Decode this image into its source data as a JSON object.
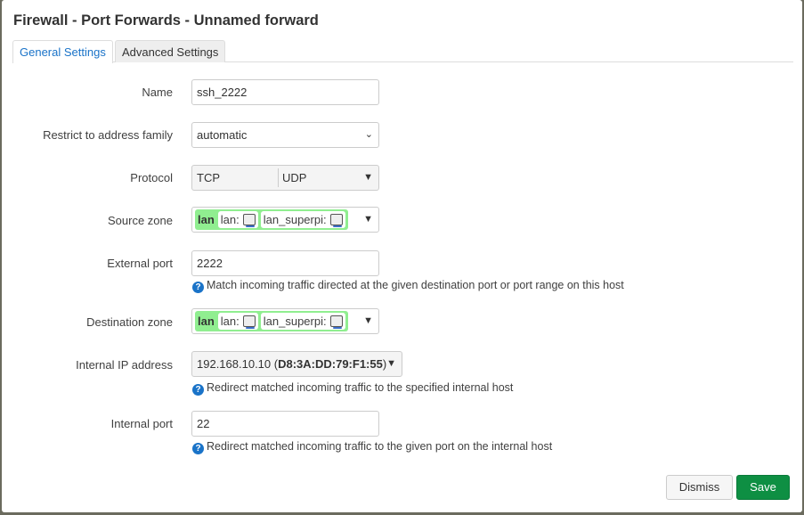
{
  "title": "Firewall - Port Forwards - Unnamed forward",
  "tabs": [
    {
      "label": "General Settings",
      "active": true
    },
    {
      "label": "Advanced Settings",
      "active": false
    }
  ],
  "fields": {
    "name": {
      "label": "Name",
      "value": "ssh_2222"
    },
    "family": {
      "label": "Restrict to address family",
      "value": "automatic"
    },
    "protocol": {
      "label": "Protocol",
      "values": [
        "TCP",
        "UDP"
      ]
    },
    "source_zone": {
      "label": "Source zone",
      "zone": "lan",
      "networks": [
        "lan:",
        "lan_superpi:"
      ]
    },
    "external_port": {
      "label": "External port",
      "value": "2222",
      "help": "Match incoming traffic directed at the given destination port or port range on this host"
    },
    "dest_zone": {
      "label": "Destination zone",
      "zone": "lan",
      "networks": [
        "lan:",
        "lan_superpi:"
      ]
    },
    "internal_ip": {
      "label": "Internal IP address",
      "ip": "192.168.10.10",
      "mac": "D8:3A:DD:79:F1:55",
      "help": "Redirect matched incoming traffic to the specified internal host"
    },
    "internal_port": {
      "label": "Internal port",
      "value": "22",
      "help": "Redirect matched incoming traffic to the given port on the internal host"
    }
  },
  "buttons": {
    "dismiss": "Dismiss",
    "save": "Save"
  },
  "colors": {
    "zone_lan": "#90ee90",
    "save": "#0e8f43",
    "tab_active": "#1a73c8"
  }
}
